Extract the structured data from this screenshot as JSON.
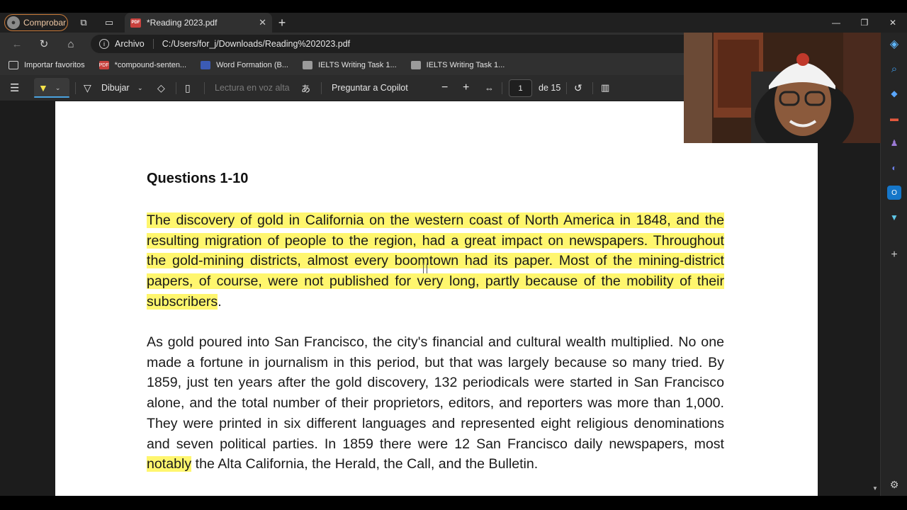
{
  "browser": {
    "profile_label": "Comprobar",
    "tab_title": "*Reading 2023.pdf",
    "tab_badge": "PDF",
    "new_tab": "+",
    "window_controls": [
      "—",
      "❐",
      "✕"
    ]
  },
  "address": {
    "site_label": "Archivo",
    "url": "C:/Users/for_j/Downloads/Reading%202023.pdf"
  },
  "favorites": [
    {
      "label": "Importar favoritos",
      "icon": "import-icon",
      "color": "#cfcfcf"
    },
    {
      "label": "*compound-senten...",
      "icon": "pdf-icon",
      "color": "#c8413d"
    },
    {
      "label": "Word Formation (B...",
      "icon": "flag-icon",
      "color": "#3b5bb5"
    },
    {
      "label": "IELTS Writing Task 1...",
      "icon": "ielts-icon",
      "color": "#9b9b9b"
    },
    {
      "label": "IELTS Writing Task 1...",
      "icon": "ielts-icon",
      "color": "#9b9b9b"
    }
  ],
  "toolbar": {
    "draw": "Dibujar",
    "read_aloud": "Lectura en voz alta",
    "ask_copilot": "Preguntar a Copilot",
    "page_current": "1",
    "page_total": "de 15",
    "highlight_color": "#fff66e"
  },
  "document": {
    "title": "Questions 1-10",
    "para1": "The discovery of gold in California on the western coast of North America in 1848, and the resulting migration of people to the region, had a great impact on newspapers. Throughout the gold-mining districts, almost every boomtown had its paper. Most of the mining-district papers, of course, were not published for very long, partly because of the mobility of their subscribers",
    "para1_end": ".",
    "para2_before": "As gold poured into San Francisco, the city's financial and cultural wealth multiplied. No one made a fortune in journalism in this period, but that was largely because so many tried. By 1859, just ten years after the gold discovery, 132 periodicals were started in San Francisco alone, and the total number of their proprietors, editors, and reporters was more than 1,000. They were printed in six different languages and represented eight religious denominations and seven political parties. In 1859 there were 12 San Francisco daily newspapers, most ",
    "para2_highlight": "notably",
    "para2_after": " the Alta California, the Herald, the Call, and the Bulletin."
  }
}
